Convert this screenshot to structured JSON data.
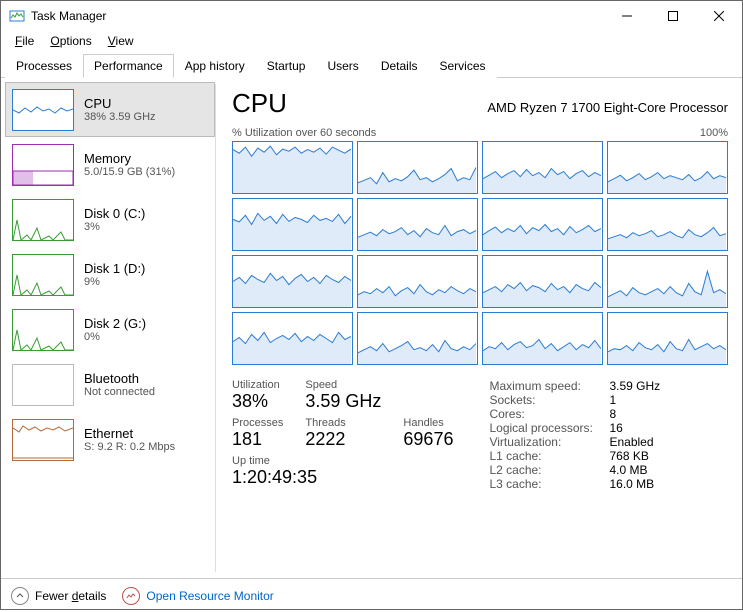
{
  "window": {
    "title": "Task Manager"
  },
  "menu": {
    "file": "File",
    "options": "Options",
    "view": "View"
  },
  "tabs": [
    "Processes",
    "Performance",
    "App history",
    "Startup",
    "Users",
    "Details",
    "Services"
  ],
  "activeTab": 1,
  "sidebar": [
    {
      "name": "CPU",
      "sub": "38% 3.59 GHz",
      "color": "#2b7cd3"
    },
    {
      "name": "Memory",
      "sub": "5.0/15.9 GB (31%)",
      "color": "#9b2fae"
    },
    {
      "name": "Disk 0 (C:)",
      "sub": "3%",
      "color": "#3a9b35"
    },
    {
      "name": "Disk 1 (D:)",
      "sub": "9%",
      "color": "#3a9b35"
    },
    {
      "name": "Disk 2 (G:)",
      "sub": "0%",
      "color": "#3a9b35"
    },
    {
      "name": "Bluetooth",
      "sub": "Not connected",
      "color": "#bbb"
    },
    {
      "name": "Ethernet",
      "sub": "S: 9.2 R: 0.2 Mbps",
      "color": "#b56a3a"
    }
  ],
  "selectedSidebar": 0,
  "main": {
    "heading": "CPU",
    "processor": "AMD Ryzen 7 1700 Eight-Core Processor",
    "graphLeft": "% Utilization over 60 seconds",
    "graphRight": "100%",
    "statsL": {
      "utilization_lbl": "Utilization",
      "utilization": "38%",
      "speed_lbl": "Speed",
      "speed": "3.59 GHz",
      "processes_lbl": "Processes",
      "processes": "181",
      "threads_lbl": "Threads",
      "threads": "2222",
      "handles_lbl": "Handles",
      "handles": "69676",
      "uptime_lbl": "Up time",
      "uptime": "1:20:49:35"
    },
    "statsR": [
      {
        "k": "Maximum speed:",
        "v": "3.59 GHz"
      },
      {
        "k": "Sockets:",
        "v": "1"
      },
      {
        "k": "Cores:",
        "v": "8"
      },
      {
        "k": "Logical processors:",
        "v": "16"
      },
      {
        "k": "Virtualization:",
        "v": "Enabled"
      },
      {
        "k": "L1 cache:",
        "v": "768 KB"
      },
      {
        "k": "L2 cache:",
        "v": "4.0 MB"
      },
      {
        "k": "L3 cache:",
        "v": "16.0 MB"
      }
    ]
  },
  "footer": {
    "fewer": "Fewer details",
    "orm": "Open Resource Monitor"
  },
  "chart_data": {
    "type": "line",
    "title": "CPU % Utilization over 60 seconds",
    "ylabel": "% Utilization",
    "ylim": [
      0,
      100
    ],
    "xlim_seconds": [
      0,
      60
    ],
    "note": "16 logical processor mini-graphs, values estimated from pixels",
    "series": [
      {
        "name": "LP0",
        "values": [
          85,
          78,
          90,
          72,
          88,
          80,
          92,
          75,
          86,
          82,
          90,
          78,
          85,
          80,
          88,
          76,
          90,
          84,
          78,
          86
        ]
      },
      {
        "name": "LP1",
        "values": [
          20,
          25,
          30,
          18,
          40,
          22,
          28,
          24,
          32,
          45,
          26,
          30,
          22,
          28,
          36,
          48,
          24,
          30,
          26,
          50
        ]
      },
      {
        "name": "LP2",
        "values": [
          28,
          35,
          42,
          30,
          38,
          44,
          32,
          46,
          34,
          40,
          30,
          48,
          36,
          42,
          28,
          38,
          44,
          32,
          40,
          34
        ]
      },
      {
        "name": "LP3",
        "values": [
          22,
          28,
          35,
          24,
          30,
          38,
          26,
          32,
          40,
          28,
          34,
          30,
          26,
          36,
          24,
          30,
          42,
          28,
          34,
          30
        ]
      },
      {
        "name": "LP4",
        "values": [
          60,
          55,
          68,
          50,
          72,
          58,
          66,
          52,
          70,
          56,
          64,
          60,
          54,
          68,
          58,
          62,
          56,
          70,
          52,
          66
        ]
      },
      {
        "name": "LP5",
        "values": [
          25,
          30,
          35,
          28,
          40,
          32,
          36,
          44,
          30,
          38,
          26,
          42,
          34,
          30,
          48,
          28,
          36,
          40,
          32,
          38
        ]
      },
      {
        "name": "LP6",
        "values": [
          30,
          38,
          45,
          34,
          42,
          36,
          48,
          32,
          44,
          38,
          50,
          36,
          42,
          30,
          46,
          34,
          40,
          48,
          36,
          42
        ]
      },
      {
        "name": "LP7",
        "values": [
          22,
          26,
          30,
          24,
          34,
          28,
          32,
          38,
          26,
          30,
          36,
          28,
          24,
          40,
          30,
          26,
          34,
          44,
          28,
          32
        ]
      },
      {
        "name": "LP8",
        "values": [
          50,
          58,
          46,
          62,
          54,
          48,
          66,
          52,
          60,
          44,
          56,
          64,
          50,
          58,
          46,
          62,
          54,
          48,
          60,
          52
        ]
      },
      {
        "name": "LP9",
        "values": [
          24,
          30,
          26,
          36,
          28,
          40,
          22,
          32,
          38,
          26,
          44,
          30,
          24,
          34,
          28,
          40,
          32,
          26,
          36,
          30
        ]
      },
      {
        "name": "LP10",
        "values": [
          28,
          34,
          40,
          30,
          44,
          36,
          48,
          32,
          42,
          38,
          30,
          46,
          34,
          40,
          28,
          44,
          36,
          32,
          48,
          38
        ]
      },
      {
        "name": "LP11",
        "values": [
          20,
          26,
          32,
          22,
          38,
          28,
          24,
          30,
          36,
          26,
          40,
          28,
          22,
          46,
          30,
          24,
          70,
          28,
          34,
          26
        ]
      },
      {
        "name": "LP12",
        "values": [
          44,
          52,
          40,
          58,
          46,
          62,
          42,
          50,
          56,
          48,
          60,
          44,
          54,
          46,
          58,
          50,
          42,
          62,
          48,
          54
        ]
      },
      {
        "name": "LP13",
        "values": [
          22,
          28,
          34,
          26,
          40,
          24,
          30,
          36,
          44,
          28,
          32,
          26,
          38,
          24,
          46,
          30,
          26,
          34,
          28,
          40
        ]
      },
      {
        "name": "LP14",
        "values": [
          26,
          34,
          30,
          42,
          28,
          38,
          44,
          32,
          36,
          48,
          30,
          40,
          26,
          34,
          42,
          28,
          38,
          32,
          46,
          30
        ]
      },
      {
        "name": "LP15",
        "values": [
          24,
          30,
          28,
          36,
          26,
          42,
          32,
          28,
          38,
          24,
          44,
          30,
          26,
          48,
          28,
          34,
          40,
          30,
          36,
          28
        ]
      }
    ]
  }
}
